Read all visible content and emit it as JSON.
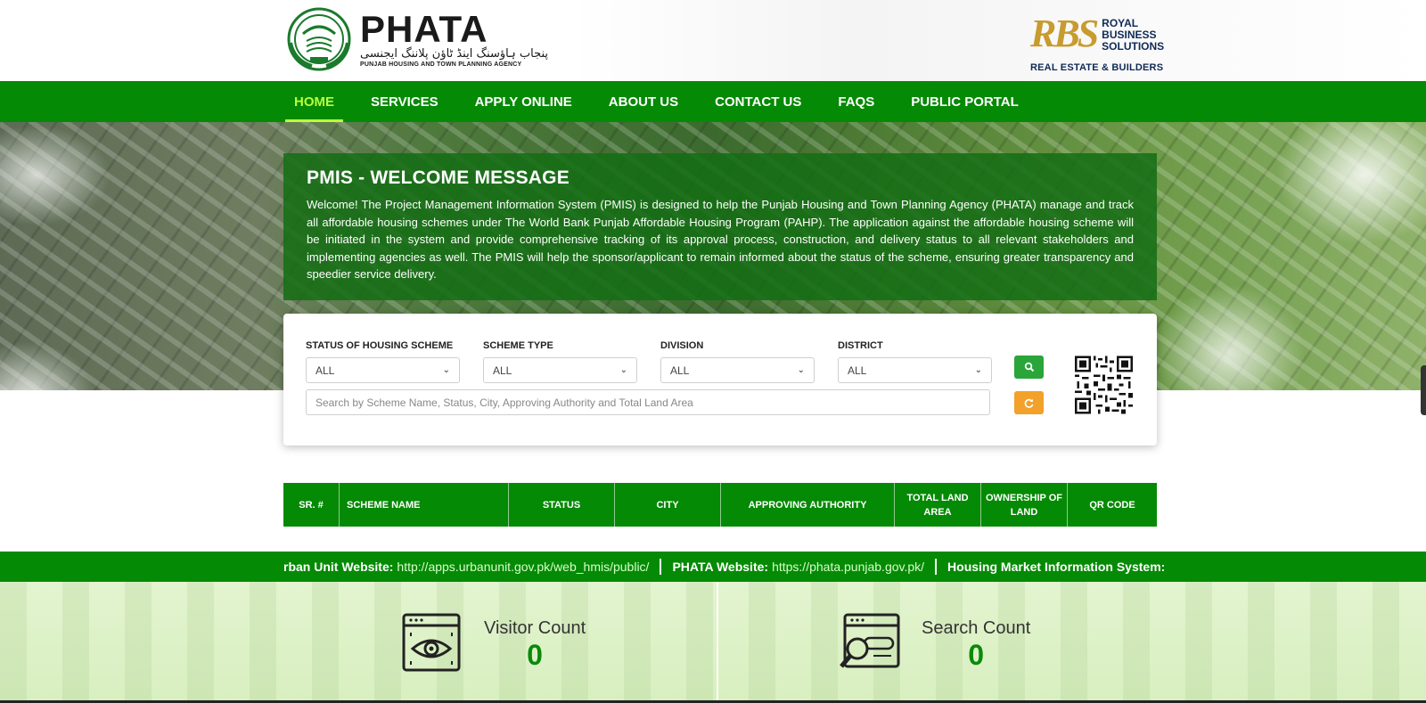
{
  "header": {
    "phata_title": "PHATA",
    "phata_urdu": "پنجاب ہاؤسنگ اینڈ ٹاؤن پلاننگ ایجنسی",
    "phata_subtitle": "PUNJAB HOUSING AND TOWN PLANNING AGENCY",
    "rbs_mark": "RBS",
    "rbs_line1": "ROYAL",
    "rbs_line2": "BUSINESS",
    "rbs_line3": "SOLUTIONS",
    "rbs_bottom": "REAL ESTATE & BUILDERS"
  },
  "nav": {
    "items": [
      {
        "label": "HOME",
        "active": true
      },
      {
        "label": "SERVICES",
        "active": false
      },
      {
        "label": "APPLY ONLINE",
        "active": false
      },
      {
        "label": "ABOUT US",
        "active": false
      },
      {
        "label": "CONTACT US",
        "active": false
      },
      {
        "label": "FAQS",
        "active": false
      },
      {
        "label": "PUBLIC PORTAL",
        "active": false
      }
    ]
  },
  "welcome": {
    "title": "PMIS - WELCOME MESSAGE",
    "body": "Welcome! The Project Management Information System (PMIS) is designed to help the Punjab Housing and Town Planning Agency (PHATA) manage and track all affordable housing schemes under The World Bank Punjab Affordable Housing Program (PAHP). The application against the affordable housing scheme will be initiated in the system and provide comprehensive tracking of its approval process, construction, and delivery status to all relevant stakeholders and implementing agencies as well. The PMIS will help the sponsor/applicant to remain informed about the status of the scheme, ensuring greater transparency and speedier service delivery."
  },
  "search": {
    "filters": [
      {
        "label": "STATUS OF HOUSING SCHEME",
        "value": "ALL"
      },
      {
        "label": "SCHEME TYPE",
        "value": "ALL"
      },
      {
        "label": "DIVISION",
        "value": "ALL"
      },
      {
        "label": "DISTRICT",
        "value": "ALL"
      }
    ],
    "placeholder": "Search by Scheme Name, Status, City, Approving Authority and Total Land Area",
    "search_icon": "search-icon",
    "reset_icon": "refresh-icon"
  },
  "table": {
    "headers": [
      "SR. #",
      "SCHEME NAME",
      "STATUS",
      "CITY",
      "APPROVING AUTHORITY",
      "TOTAL LAND AREA",
      "OWNERSHIP OF LAND",
      "QR CODE"
    ]
  },
  "ticker": {
    "item1_label": "rban Unit Website:",
    "item1_link": "http://apps.urbanunit.gov.pk/web_hmis/public/",
    "item2_label": "PHATA Website:",
    "item2_link": "https://phata.punjab.gov.pk/",
    "item3_label": "Housing Market Information System:"
  },
  "stats": {
    "visitor_label": "Visitor Count",
    "visitor_value": "0",
    "search_label": "Search Count",
    "search_value": "0"
  },
  "colors": {
    "primary_green": "#058a05",
    "active_nav": "#b8ff3c",
    "search_button": "#2aa53a",
    "reset_button": "#f2a12b"
  }
}
